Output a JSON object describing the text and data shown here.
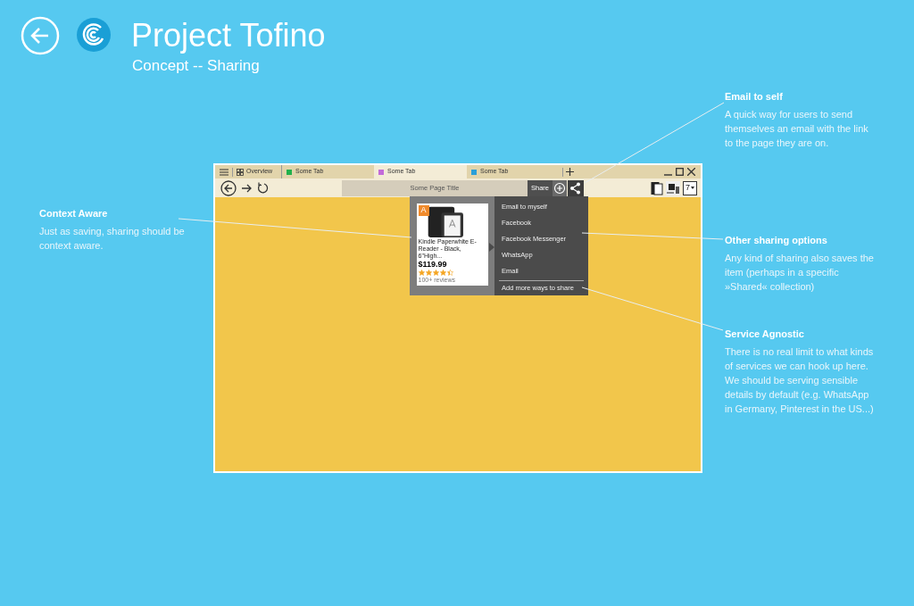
{
  "header": {
    "title": "Project Tofino",
    "subtitle": "Concept -- Sharing"
  },
  "browser": {
    "overview_label": "Overview",
    "tabs": [
      {
        "label": "Some Tab",
        "color": "#22b14c",
        "selected": false
      },
      {
        "label": "Some Tab",
        "color": "#c36bd9",
        "selected": true
      },
      {
        "label": "Some Tab",
        "color": "#2a9fd8",
        "selected": false
      }
    ],
    "page_title": "Some Page Title",
    "share_label": "Share",
    "count_badge": "7",
    "product": {
      "badge": "A",
      "name": "Kindle Paperwhite E-Reader - Black, 6\"High...",
      "price": "$119.99",
      "stars": 4.5,
      "reviews": "100+ reviews"
    },
    "menu": {
      "items": [
        "Email to myself",
        "Facebook",
        "Facebook Messenger",
        "WhatsApp",
        "Email"
      ],
      "footer": "Add more ways to share"
    }
  },
  "annotations": [
    {
      "title": "Email to self",
      "body": "A quick way for users to send themselves an email with the link to the page they are on."
    },
    {
      "title": "Context Aware",
      "body": "Just as saving, sharing should be context aware."
    },
    {
      "title": "Other sharing options",
      "body": "Any kind of sharing also saves the item (perhaps in a specific »Shared« collection)"
    },
    {
      "title": "Service Agnostic",
      "body": "There is no real limit to what kinds of services we can hook up here. We should be serving sensible details by default (e.g. WhatsApp in Germany, Pinterest in the US...)"
    }
  ]
}
